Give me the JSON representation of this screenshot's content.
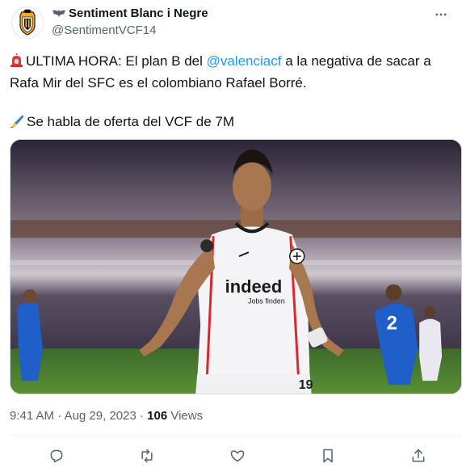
{
  "author": {
    "display_name": "Sentiment Blanc i Negre",
    "handle": "@SentimentVCF14",
    "avatar_icon": "valencia-cf-crest-icon",
    "name_prefix_icon": "bat-icon"
  },
  "tweet": {
    "line1_emoji": "🚨",
    "line1_before": "ULTIMA HORA: El plan B del ",
    "mention": "@valenciacf",
    "line1_after": " a la negativa de sacar a Rafa Mir del SFC es el colombiano Rafael Borré.",
    "line2_emoji": "✍️",
    "line2_text": "Se habla de oferta del VCF de 7M"
  },
  "media": {
    "sponsor_text": "indeed",
    "sponsor_sub": "Jobs finden",
    "player_number": "19",
    "opponent_number": "2"
  },
  "meta": {
    "time": "9:41 AM",
    "separator": " · ",
    "date": "Aug 29, 2023",
    "separator2": " · ",
    "views_count": "106",
    "views_label": " Views"
  },
  "actions": {
    "reply_icon": "reply-icon",
    "retweet_icon": "retweet-icon",
    "like_icon": "heart-icon",
    "bookmark_icon": "bookmark-icon",
    "share_icon": "share-icon"
  },
  "colors": {
    "link": "#1d9bf0",
    "secondary": "#536471",
    "text": "#0f1419"
  }
}
